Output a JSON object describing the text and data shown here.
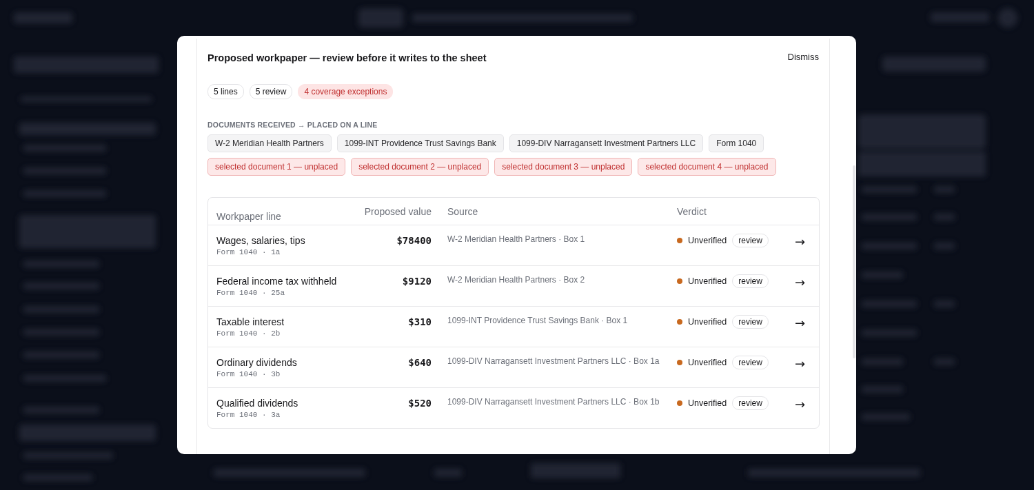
{
  "dialog": {
    "title": "Proposed workpaper — review before it writes to the sheet",
    "dismiss": "Dismiss",
    "counts": [
      {
        "label": "5 lines",
        "kind": "neutral"
      },
      {
        "label": "5 review",
        "kind": "neutral"
      },
      {
        "label": "4 coverage exceptions",
        "kind": "exception"
      }
    ],
    "documents_heading": "DOCUMENTS RECEIVED → PLACED ON A LINE",
    "documents": [
      {
        "label": "W-2 Meridian Health Partners",
        "placed": true
      },
      {
        "label": "1099-INT Providence Trust Savings Bank",
        "placed": true
      },
      {
        "label": "1099-DIV Narragansett Investment Partners LLC",
        "placed": true
      },
      {
        "label": "Form 1040",
        "placed": true
      },
      {
        "label": "selected document 1 — unplaced",
        "placed": false
      },
      {
        "label": "selected document 2 — unplaced",
        "placed": false
      },
      {
        "label": "selected document 3 — unplaced",
        "placed": false
      },
      {
        "label": "selected document 4 — unplaced",
        "placed": false
      }
    ],
    "table": {
      "columns": [
        "Workpaper line",
        "Proposed value",
        "Source",
        "Verdict"
      ],
      "rows": [
        {
          "line": "Wages, salaries, tips",
          "ref": "Form 1040 · 1a",
          "value": "$78400",
          "source": "W-2 Meridian Health Partners · Box 1",
          "verdict": "Unverified",
          "color": "#c8691f",
          "tag": "review",
          "arrow": "→"
        },
        {
          "line": "Federal income tax withheld",
          "ref": "Form 1040 · 25a",
          "value": "$9120",
          "source": "W-2 Meridian Health Partners · Box 2",
          "verdict": "Unverified",
          "color": "#c8691f",
          "tag": "review",
          "arrow": "→"
        },
        {
          "line": "Taxable interest",
          "ref": "Form 1040 · 2b",
          "value": "$310",
          "source": "1099-INT Providence Trust Savings Bank · Box 1",
          "verdict": "Unverified",
          "color": "#c8691f",
          "tag": "review",
          "arrow": "→"
        },
        {
          "line": "Ordinary dividends",
          "ref": "Form 1040 · 3b",
          "value": "$640",
          "source": "1099-DIV Narragansett Investment Partners LLC · Box 1a",
          "verdict": "Unverified",
          "color": "#c8691f",
          "tag": "review",
          "arrow": "→"
        },
        {
          "line": "Qualified dividends",
          "ref": "Form 1040 · 3a",
          "value": "$520",
          "source": "1099-DIV Narragansett Investment Partners LLC · Box 1b",
          "verdict": "Unverified",
          "color": "#c8691f",
          "tag": "review",
          "arrow": "→"
        }
      ]
    }
  }
}
